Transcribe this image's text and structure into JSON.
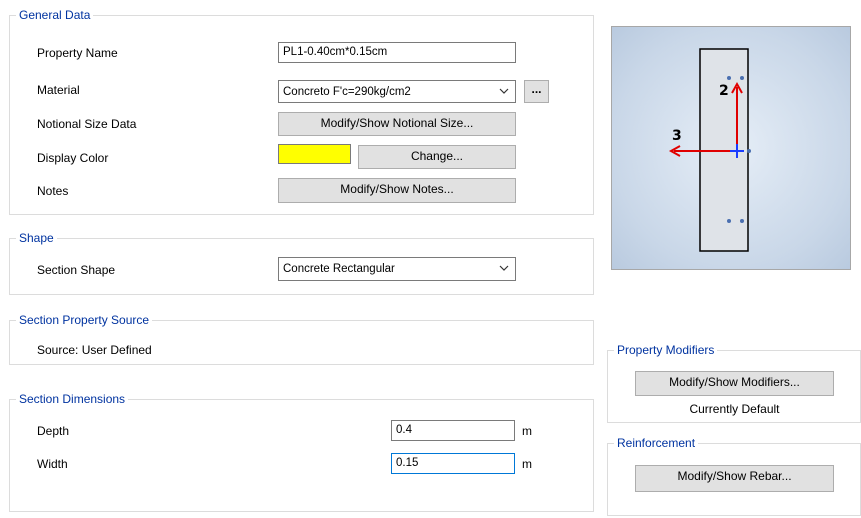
{
  "general": {
    "title": "General Data",
    "property_name_label": "Property Name",
    "property_name_value": "PL1-0.40cm*0.15cm",
    "material_label": "Material",
    "material_value": "Concreto F'c=290kg/cm2",
    "material_browse": "...",
    "notional_label": "Notional Size Data",
    "notional_button": "Modify/Show Notional Size...",
    "display_color_label": "Display Color",
    "display_color_value": "#ffff00",
    "change_button": "Change...",
    "notes_label": "Notes",
    "notes_button": "Modify/Show Notes..."
  },
  "shape": {
    "title": "Shape",
    "section_shape_label": "Section Shape",
    "section_shape_value": "Concrete Rectangular"
  },
  "source": {
    "title": "Section Property Source",
    "source_text": "Source:  User Defined"
  },
  "dimensions": {
    "title": "Section Dimensions",
    "depth_label": "Depth",
    "depth_value": "0.4",
    "depth_unit": "m",
    "width_label": "Width",
    "width_value": "0.15",
    "width_unit": "m"
  },
  "preview": {
    "axis_2_label": "2",
    "axis_3_label": "3",
    "axis_2_color": "#e00000",
    "axis_3_color": "#e00000",
    "origin_color": "#1a3cff"
  },
  "modifiers": {
    "title": "Property Modifiers",
    "button": "Modify/Show Modifiers...",
    "status": "Currently Default"
  },
  "reinforcement": {
    "title": "Reinforcement",
    "button": "Modify/Show Rebar..."
  }
}
